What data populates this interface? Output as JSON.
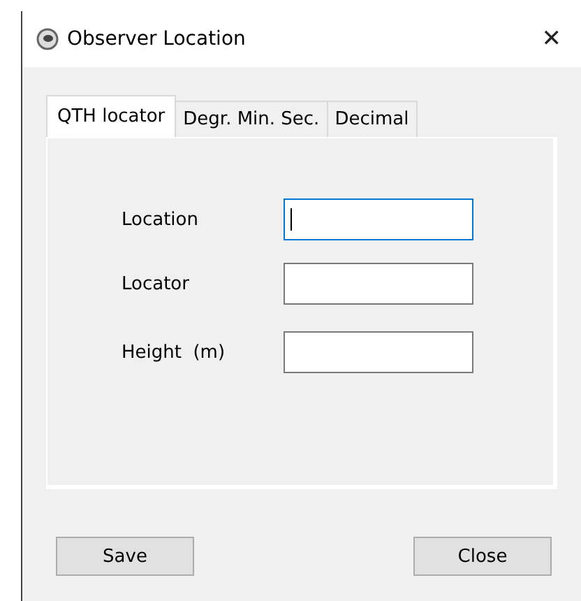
{
  "window": {
    "title": "Observer Location",
    "close": "✕"
  },
  "tabs": [
    {
      "label": "QTH locator",
      "selected": true
    },
    {
      "label": "Degr. Min. Sec.",
      "selected": false
    },
    {
      "label": "Decimal",
      "selected": false
    }
  ],
  "fields": [
    {
      "label": "Location",
      "focused": true
    },
    {
      "label": "Locator",
      "focused": false
    },
    {
      "label": "Height  (m)",
      "focused": false
    }
  ],
  "buttons": [
    "Save",
    "Close"
  ]
}
